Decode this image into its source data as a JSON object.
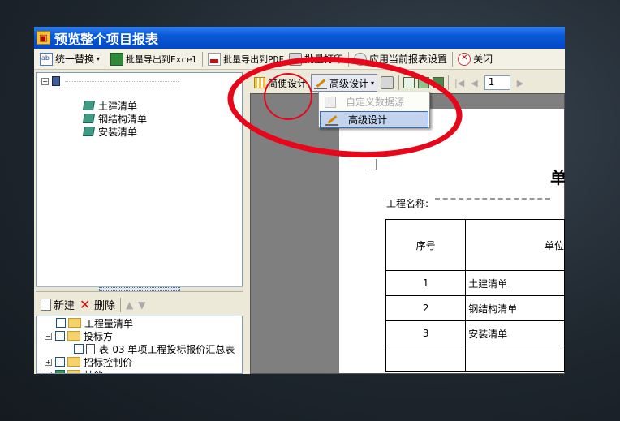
{
  "window": {
    "title": "预览整个项目报表"
  },
  "toolbar": {
    "replace_label": "统一替换",
    "export_excel_label": "批量导出到Excel",
    "export_pdf_label": "批量导出到PDF",
    "batch_print_label": "批量打印",
    "apply_settings_label": "应用当前报表设置",
    "close_label": "关闭"
  },
  "left_tree": {
    "items": [
      {
        "label": "土建清单",
        "icon": "cube-icon"
      },
      {
        "label": "钢结构清单",
        "icon": "cube-icon"
      },
      {
        "label": "安装清单",
        "icon": "cube-icon"
      }
    ]
  },
  "bottom_toolbar": {
    "new_label": "新建",
    "delete_label": "删除"
  },
  "report_tree": {
    "items": [
      {
        "label": "工程量清单",
        "level": 0,
        "expander": ""
      },
      {
        "label": "投标方",
        "level": 0,
        "expander": "−"
      },
      {
        "label": "表-03 单项工程投标报价汇总表",
        "level": 1,
        "expander": ""
      },
      {
        "label": "招标控制价",
        "level": 0,
        "expander": "+"
      },
      {
        "label": "其他",
        "level": 0,
        "expander": "+"
      }
    ]
  },
  "report_toolbar": {
    "simple_design_label": "简便设计",
    "advanced_design_label": "高级设计",
    "page_number": "1"
  },
  "dropdown": {
    "items": [
      {
        "label": "自定义数据源",
        "state": "disabled"
      },
      {
        "label": "高级设计",
        "state": "selected"
      }
    ]
  },
  "report": {
    "title_fragment": "单",
    "project_name_label": "工程名称:",
    "header": {
      "seq": "序号",
      "unit_fragment": "单位"
    },
    "rows": [
      {
        "seq": "1",
        "name": "土建清单"
      },
      {
        "seq": "2",
        "name": "钢结构清单"
      },
      {
        "seq": "3",
        "name": "安装清单"
      },
      {
        "seq": "",
        "name": ""
      }
    ]
  },
  "colors": {
    "titlebar": "#0a5ad8",
    "annotation_red": "#e8061a",
    "selection": "#c2d3ee"
  }
}
